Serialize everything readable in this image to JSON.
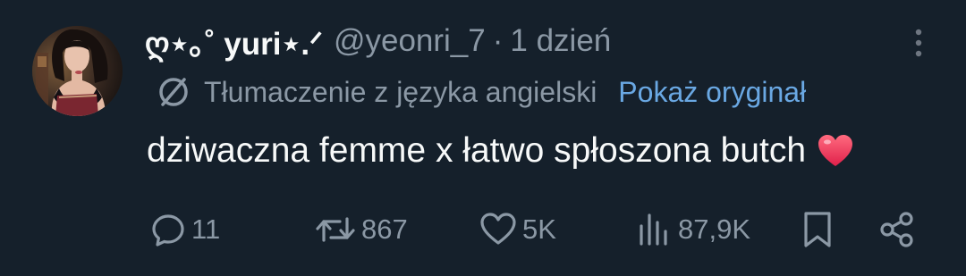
{
  "tweet": {
    "display_name": "ღ⋆｡˚ yuri⋆.ᐟ",
    "handle": "@yeonri_7",
    "separator": "·",
    "time": "1 dzień",
    "translation_label": "Tłumaczenie z języka angielski",
    "show_original": "Pokaż oryginał",
    "text": "dziwaczna femme x łatwo spłoszona butch",
    "emoji": "red-heart"
  },
  "actions": {
    "replies": "11",
    "reposts": "867",
    "likes": "5K",
    "views": "87,9K"
  },
  "icons": {
    "more": "more-vertical-icon",
    "translate": "translate-icon",
    "reply": "reply-icon",
    "repost": "repost-icon",
    "like": "heart-icon",
    "views": "views-icon",
    "bookmark": "bookmark-icon",
    "share": "share-icon"
  },
  "colors": {
    "background": "#15202b",
    "text_primary": "#f7f9f9",
    "text_secondary": "#8b98a5",
    "link": "#6aa8e3",
    "heart": "#f0304f"
  }
}
